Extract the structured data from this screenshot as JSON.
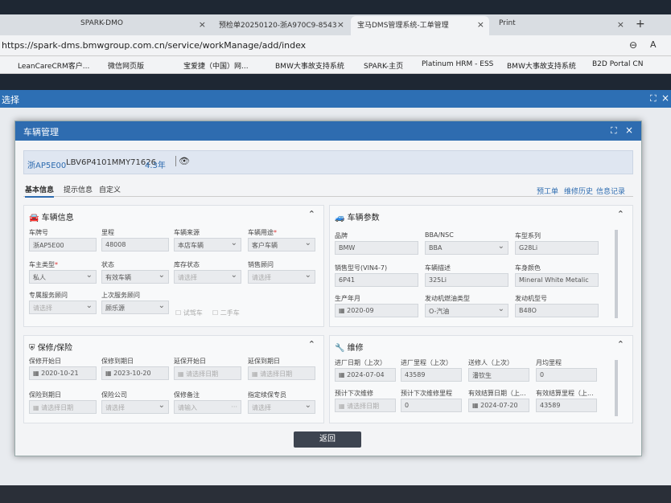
{
  "browser": {
    "tabs": [
      {
        "title": "SPARK-DMO",
        "active": false
      },
      {
        "title": "预检单20250120-浙A970C9-8543",
        "active": false
      },
      {
        "title": "宝马DMS管理系统-工单管理",
        "active": true
      },
      {
        "title": "Print",
        "active": false
      }
    ],
    "url": "https://spark-dms.bmwgroup.com.cn/service/workManage/add/index",
    "bookmarks": [
      "LeanCareCRM客户...",
      "微信网页版",
      "宝爱捷（中国）网...",
      "BMW大事故支持系统",
      "SPARK-主页",
      "Platinum HRM - ESS",
      "BMW大事故支持系统",
      "B2D Portal CN"
    ]
  },
  "outer": {
    "title": "选择"
  },
  "dialog": {
    "title": "车辆管理",
    "plate": "浙AP5E00",
    "vin": "LBV6P4101MMY71626",
    "age": "4.3年",
    "tabs": [
      "基本信息",
      "提示信息",
      "自定义"
    ],
    "links": [
      "预工单",
      "维修历史",
      "信息记录"
    ],
    "vehicle_info": {
      "title": "车辆信息",
      "fields": [
        {
          "label": "车牌号",
          "value": "浙AP5E00"
        },
        {
          "label": "里程",
          "value": "48008"
        },
        {
          "label": "车辆来源",
          "value": "本店车辆"
        },
        {
          "label": "车辆用途",
          "value": "客户车辆"
        },
        {
          "label": "车主类型",
          "value": "私人"
        },
        {
          "label": "状态",
          "value": "有效车辆"
        },
        {
          "label": "库存状态",
          "value": "请选择"
        },
        {
          "label": "销售顾问",
          "value": "请选择"
        },
        {
          "label": "专属服务顾问",
          "value": "请选择"
        },
        {
          "label": "上次服务顾问",
          "value": "顾乐源"
        }
      ],
      "checkboxes": [
        "试驾车",
        "二手车"
      ]
    },
    "vehicle_params": {
      "title": "车辆参数",
      "fields": [
        {
          "label": "品牌",
          "value": "BMW"
        },
        {
          "label": "BBA/NSC",
          "value": "BBA"
        },
        {
          "label": "车型系列",
          "value": "G28Li"
        },
        {
          "label": "销售型号(VIN4-7)",
          "value": "6P41"
        },
        {
          "label": "车辆描述",
          "value": "325Li"
        },
        {
          "label": "车身颜色",
          "value": "Mineral White Metalic"
        },
        {
          "label": "生产年月",
          "value": "2020-09"
        },
        {
          "label": "发动机燃油类型",
          "value": "O-汽油"
        },
        {
          "label": "发动机型号",
          "value": "B48O"
        }
      ]
    },
    "warranty": {
      "title": "保修/保险",
      "fields": [
        {
          "label": "保修开始日",
          "value": "2020-10-21"
        },
        {
          "label": "保修到期日",
          "value": "2023-10-20"
        },
        {
          "label": "延保开始日",
          "value": "请选择日期"
        },
        {
          "label": "延保到期日",
          "value": "请选择日期"
        },
        {
          "label": "保险到期日",
          "value": "请选择日期"
        },
        {
          "label": "保险公司",
          "value": "请选择"
        },
        {
          "label": "保修备注",
          "value": "请输入"
        },
        {
          "label": "指定续保专员",
          "value": "请选择"
        }
      ]
    },
    "maintenance": {
      "title": "维修",
      "fields": [
        {
          "label": "进厂日期（上次）",
          "value": "2024-07-04"
        },
        {
          "label": "进厂里程（上次）",
          "value": "43589"
        },
        {
          "label": "送修人（上次）",
          "value": "潘钦生"
        },
        {
          "label": "月均里程",
          "value": "0"
        },
        {
          "label": "预计下次维修",
          "value": "请选择日期"
        },
        {
          "label": "预计下次维修里程",
          "value": "0"
        },
        {
          "label": "有效结算日期（上...",
          "value": "2024-07-20"
        },
        {
          "label": "有效结算里程（上...",
          "value": "43589"
        }
      ]
    },
    "back_label": "返回"
  }
}
